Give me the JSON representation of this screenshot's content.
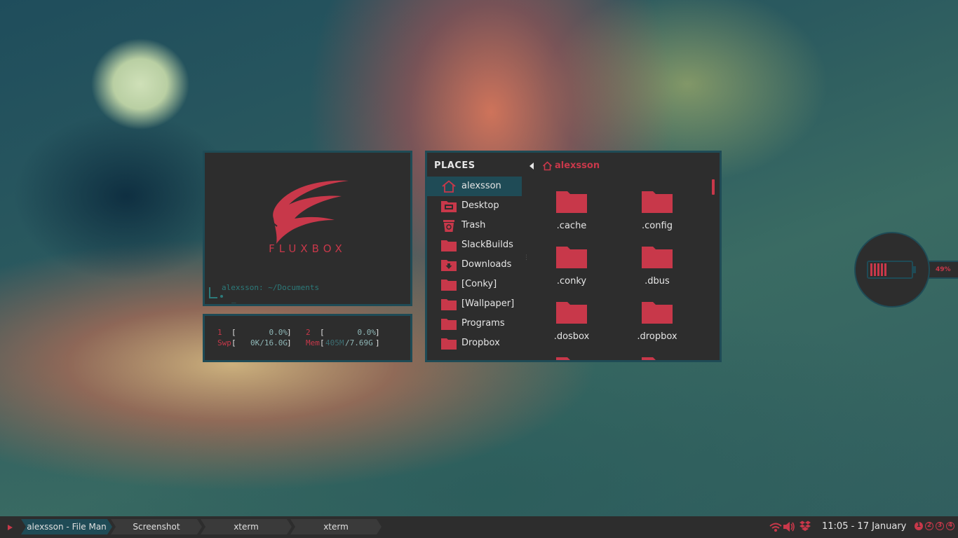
{
  "terminal": {
    "logo_text": "FLUXBOX",
    "prompt": "alexsson: ~/Documents",
    "cursor": "_"
  },
  "htop": {
    "cpu1_label": "1",
    "cpu1_value": "0.0%",
    "cpu2_label": "2",
    "cpu2_value": "0.0%",
    "swap_label": "Swp",
    "swap_value": "0K/16.0G",
    "mem_label": "Mem",
    "mem_used": "405M",
    "mem_total": "/7.69G"
  },
  "filemanager": {
    "places_title": "PLACES",
    "breadcrumb": "alexsson",
    "places": [
      {
        "label": "alexsson",
        "icon": "home-icon"
      },
      {
        "label": "Desktop",
        "icon": "desktop-icon"
      },
      {
        "label": "Trash",
        "icon": "trash-icon"
      },
      {
        "label": "SlackBuilds",
        "icon": "folder-icon"
      },
      {
        "label": "Downloads",
        "icon": "download-folder-icon"
      },
      {
        "label": "[Conky]",
        "icon": "folder-icon"
      },
      {
        "label": "[Wallpaper]",
        "icon": "folder-icon"
      },
      {
        "label": "Programs",
        "icon": "folder-icon"
      },
      {
        "label": "Dropbox",
        "icon": "folder-icon"
      }
    ],
    "files": [
      ".cache",
      ".config",
      ".conky",
      ".dbus",
      ".dosbox",
      ".dropbox"
    ]
  },
  "battery": {
    "percent_label": "49%",
    "level": 0.49
  },
  "taskbar": {
    "tasks": [
      "alexsson - File Man",
      "Screenshot",
      "xterm",
      "xterm"
    ],
    "clock": "11:05 - 17 January",
    "workspaces": [
      "1",
      "2",
      "3",
      "4"
    ]
  },
  "colors": {
    "accent": "#c8384a",
    "border": "#1f4b56",
    "panel": "#2d2d2d",
    "terminal_text": "#2c7a7a"
  }
}
